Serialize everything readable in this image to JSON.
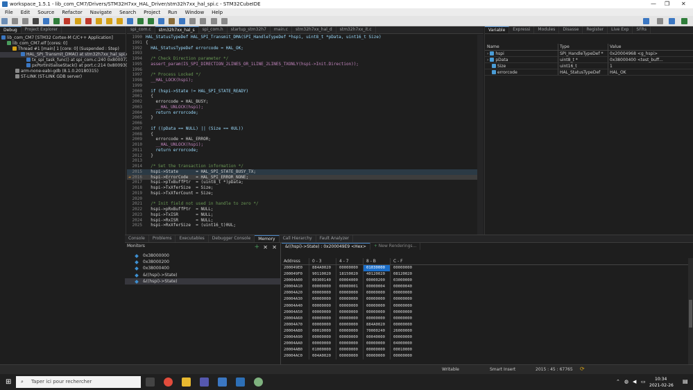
{
  "window": {
    "title": "workspace_1.5.1 - lib_com_CM7/Drivers/STM32H7xx_HAL_Driver/stm32h7xx_hal_spi.c - STM32CubeIDE"
  },
  "menu": [
    "File",
    "Edit",
    "Source",
    "Refactor",
    "Navigate",
    "Search",
    "Project",
    "Run",
    "Window",
    "Help"
  ],
  "debug_view": {
    "tabs": [
      "Debug",
      "Project Explorer"
    ],
    "tree": [
      "lib_com_CM7 [STM32 Cortex-M C/C++ Application]",
      "lib_com_CM7.elf [cores: 0]",
      "Thread #1 [main] 1 [core: 0] (Suspended : Step)",
      "HAL_SPI_Transmit_DMA() at stm32h7xx_hal_spi.c",
      "tx_spi_task_func() at spi_com.c:240 0x8000770",
      "pxPortInitialiseStack() at port.c:214 0x800930c",
      "arm-none-eabi-gdb (8.1.0.20180315)",
      "ST-LINK (ST-LINK GDB server)"
    ]
  },
  "editor": {
    "tabs": [
      "spi_com.c",
      "stm32h7xx_hal_s",
      "spi_com.h",
      "startup_stm32h7",
      "main.c",
      "stm32h7xx_hal_d",
      "stm32h7xx_it.c"
    ],
    "active_tab": 1,
    "lines": [
      {
        "n": "1990",
        "t": "HAL_StatusTypeDef HAL_SPI_Transmit_DMA(SPI_HandleTypeDef *hspi, uint8_t *pData, uint16_t Size)"
      },
      {
        "n": "1991",
        "t": "{"
      },
      {
        "n": "1992",
        "t": "  HAL_StatusTypeDef errorcode = HAL_OK;"
      },
      {
        "n": "1993",
        "t": ""
      },
      {
        "n": "1994",
        "t": "  /* Check Direction parameter */"
      },
      {
        "n": "1995",
        "t": "  assert_param(IS_SPI_DIRECTION_2LINES_OR_1LINE_2LINES_TXONLY(hspi->Init.Direction));"
      },
      {
        "n": "1996",
        "t": ""
      },
      {
        "n": "1997",
        "t": "  /* Process Locked */"
      },
      {
        "n": "1998",
        "t": "  __HAL_LOCK(hspi);"
      },
      {
        "n": "1999",
        "t": ""
      },
      {
        "n": "2000",
        "t": "  if (hspi->State != HAL_SPI_STATE_READY)"
      },
      {
        "n": "2001",
        "t": "  {"
      },
      {
        "n": "2002",
        "t": "    errorcode = HAL_BUSY;"
      },
      {
        "n": "2003",
        "t": "    __HAL_UNLOCK(hspi);"
      },
      {
        "n": "2004",
        "t": "    return errorcode;"
      },
      {
        "n": "2005",
        "t": "  }"
      },
      {
        "n": "2006",
        "t": ""
      },
      {
        "n": "2007",
        "t": "  if ((pData == NULL) || (Size == 0UL))"
      },
      {
        "n": "2008",
        "t": "  {"
      },
      {
        "n": "2009",
        "t": "    errorcode = HAL_ERROR;"
      },
      {
        "n": "2010",
        "t": "    __HAL_UNLOCK(hspi);"
      },
      {
        "n": "2011",
        "t": "    return errorcode;"
      },
      {
        "n": "2012",
        "t": "  }"
      },
      {
        "n": "2013",
        "t": ""
      },
      {
        "n": "2014",
        "t": "  /* Set the transaction information */"
      },
      {
        "n": "2015",
        "t": "  hspi->State       = HAL_SPI_STATE_BUSY_TX;"
      },
      {
        "n": "2016",
        "t": "  hspi->ErrorCode   = HAL_SPI_ERROR_NONE;"
      },
      {
        "n": "2017",
        "t": "  hspi->pTxBuffPtr  = (uint8_t *)pData;"
      },
      {
        "n": "2018",
        "t": "  hspi->TxXferSize  = Size;"
      },
      {
        "n": "2019",
        "t": "  hspi->TxXferCount = Size;"
      },
      {
        "n": "2020",
        "t": ""
      },
      {
        "n": "2021",
        "t": "  /* Init field not used in handle to zero */"
      },
      {
        "n": "2022",
        "t": "  hspi->pRxBuffPtr  = NULL;"
      },
      {
        "n": "2023",
        "t": "  hspi->TxISR       = NULL;"
      },
      {
        "n": "2024",
        "t": "  hspi->RxISR       = NULL;"
      },
      {
        "n": "2025",
        "t": "  hspi->RxXferSize  = (uint16_t)0UL;"
      }
    ]
  },
  "variables_view": {
    "tabs": [
      "Variable",
      "Expressi",
      "Modules",
      "Disasse",
      "Register",
      "Live Exp",
      "SFRs"
    ],
    "columns": [
      "Name",
      "Type",
      "Value"
    ],
    "rows": [
      {
        "name": "hspi",
        "type": "SPI_HandleTypeDef *",
        "value": "0x20004968 <g_hspi>"
      },
      {
        "name": "pData",
        "type": "uint8_t *",
        "value": "0x38000400 <test_buff..."
      },
      {
        "name": "Size",
        "type": "uint16_t",
        "value": "1"
      },
      {
        "name": "errorcode",
        "type": "HAL_StatusTypeDef",
        "value": "HAL_OK"
      }
    ]
  },
  "bottom_tabs": [
    "Console",
    "Problems",
    "Executables",
    "Debugger Console",
    "Memory",
    "Call Hierarchy",
    "Fault Analyzer"
  ],
  "monitors": {
    "label": "Monitors",
    "items": [
      "0x38000000",
      "0x38000200",
      "0x38000400",
      "&((hspi)->State)",
      "&((hspi)->State)"
    ]
  },
  "memory": {
    "rendering_tab": "&((hspi)->State) : 0x200049E9 <Hex>",
    "new_renderings": "New Renderings...",
    "columns": [
      "Address",
      "0 - 3",
      "4 - 7",
      "8 - B",
      "C - F"
    ],
    "rows": [
      [
        "200049E0",
        "884A0020",
        "00000000",
        "01030000",
        "00000000"
      ],
      [
        "200049F0",
        "90110020",
        "18150020",
        "40120020",
        "08120020"
      ],
      [
        "20004A00",
        "00300140",
        "00004000",
        "00000200",
        "03000000"
      ],
      [
        "20004A10",
        "00000000",
        "00000001",
        "00000004",
        "00000040"
      ],
      [
        "20004A20",
        "00000000",
        "00000000",
        "00000000",
        "00000000"
      ],
      [
        "20004A30",
        "00000000",
        "00000000",
        "00000000",
        "00000000"
      ],
      [
        "20004A40",
        "00000000",
        "00000000",
        "00000000",
        "00000000"
      ],
      [
        "20004A50",
        "00000000",
        "00000000",
        "00000000",
        "00000000"
      ],
      [
        "20004A60",
        "00000000",
        "00000000",
        "00000000",
        "00000000"
      ],
      [
        "20004A70",
        "00000000",
        "00000000",
        "884A0020",
        "00000000"
      ],
      [
        "20004A80",
        "00010000",
        "00000000",
        "70000240",
        "26000000"
      ],
      [
        "20004A90",
        "00000000",
        "00000000",
        "00040000",
        "00000000"
      ],
      [
        "20004AA0",
        "00000000",
        "00000000",
        "00000000",
        "04000000"
      ],
      [
        "20004AB0",
        "01000000",
        "00000000",
        "00000000",
        "00010000"
      ],
      [
        "20004AC0",
        "004A0020",
        "00000000",
        "00000000",
        "00000000"
      ]
    ]
  },
  "status_bar": {
    "writable": "Writable",
    "insert": "Smart Insert",
    "position": "2015 : 45 : 67765"
  },
  "taskbar": {
    "search_placeholder": "Taper ici pour rechercher",
    "time": "10:34",
    "date": "2021-02-26"
  },
  "colors": {
    "accent": "#1a6dc8",
    "editor_bg": "#1e1e1e",
    "keyword": "#569cd6",
    "comment": "#6a9955",
    "macro": "#c586c0"
  }
}
